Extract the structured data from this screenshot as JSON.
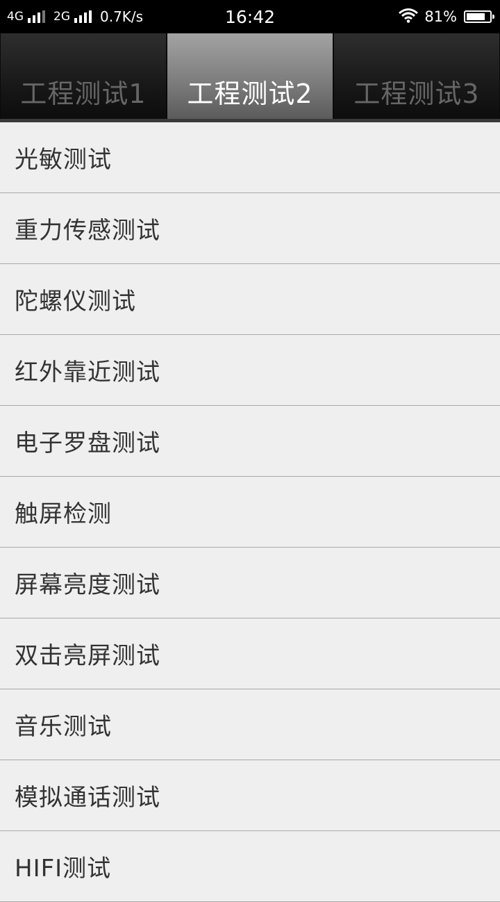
{
  "status_bar": {
    "net1": "4G",
    "net2": "2G",
    "speed": "0.7K/s",
    "time": "16:42",
    "battery": "81%",
    "battery_level": 0.81,
    "icons": [
      "signal-icon",
      "wifi-icon",
      "battery-icon"
    ]
  },
  "tabs": [
    {
      "label": "工程测试1",
      "active": false
    },
    {
      "label": "工程测试2",
      "active": true
    },
    {
      "label": "工程测试3",
      "active": false
    }
  ],
  "items": [
    {
      "label": "光敏测试"
    },
    {
      "label": "重力传感测试"
    },
    {
      "label": "陀螺仪测试"
    },
    {
      "label": "红外靠近测试"
    },
    {
      "label": "电子罗盘测试"
    },
    {
      "label": "触屏检测"
    },
    {
      "label": "屏幕亮度测试"
    },
    {
      "label": "双击亮屏测试"
    },
    {
      "label": "音乐测试"
    },
    {
      "label": "模拟通话测试"
    },
    {
      "label": "HIFI测试"
    }
  ],
  "colors": {
    "status_bg": "#000000",
    "active_tab_text": "#ffffff",
    "inactive_tab_text": "#666666",
    "list_bg": "#efefef",
    "list_text": "#333333"
  }
}
